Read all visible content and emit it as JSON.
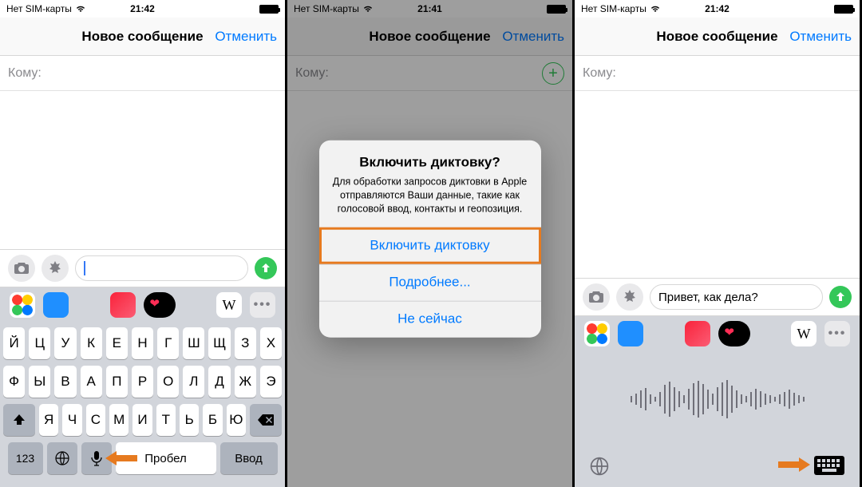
{
  "status": {
    "carrier": "Нет SIM-карты",
    "time1": "21:42",
    "time2": "21:41",
    "time3": "21:42"
  },
  "nav": {
    "title": "Новое сообщение",
    "cancel": "Отменить"
  },
  "to_label": "Кому:",
  "compose": {
    "typed_text": "Привет, как дела?"
  },
  "keyboard": {
    "row1": [
      "Й",
      "Ц",
      "У",
      "К",
      "Е",
      "Н",
      "Г",
      "Ш",
      "Щ",
      "З",
      "Х"
    ],
    "row2": [
      "Ф",
      "Ы",
      "В",
      "А",
      "П",
      "Р",
      "О",
      "Л",
      "Д",
      "Ж",
      "Э"
    ],
    "row3": [
      "Я",
      "Ч",
      "С",
      "М",
      "И",
      "Т",
      "Ь",
      "Б",
      "Ю"
    ],
    "k123": "123",
    "space": "Пробел",
    "enter": "Ввод"
  },
  "suggestions": {
    "w_label": "W",
    "more_label": "•••"
  },
  "alert": {
    "title": "Включить диктовку?",
    "message": "Для обработки запросов диктовки в Apple отправляются Ваши данные, такие как голосовой ввод, контакты и геопозиция.",
    "enable": "Включить диктовку",
    "more": "Подробнее...",
    "later": "Не сейчас"
  },
  "waveform_heights": [
    8,
    14,
    22,
    28,
    12,
    6,
    18,
    36,
    44,
    30,
    20,
    10,
    26,
    40,
    46,
    38,
    24,
    14,
    30,
    42,
    48,
    34,
    22,
    12,
    8,
    18,
    26,
    20,
    14,
    10,
    6,
    12,
    18,
    24,
    16,
    10,
    6
  ]
}
